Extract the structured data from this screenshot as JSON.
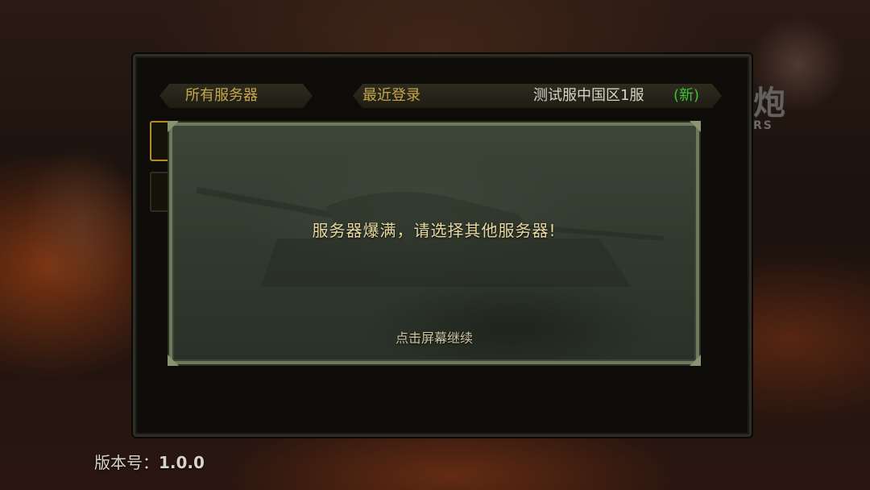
{
  "tabs": {
    "all_servers": "所有服务器",
    "recent_login": "最近登录",
    "recent_server_name": "测试服中国区1服",
    "recent_server_tag": "(新)"
  },
  "dialog": {
    "message": "服务器爆满，请选择其他服务器!",
    "hint": "点击屏幕继续"
  },
  "footer": {
    "version_label": "版本号：",
    "version_value": "1.0.0"
  },
  "colors": {
    "accent_gold": "#c6a64a",
    "new_tag_green": "#3ec23a",
    "selected_border": "#b68b2a"
  }
}
